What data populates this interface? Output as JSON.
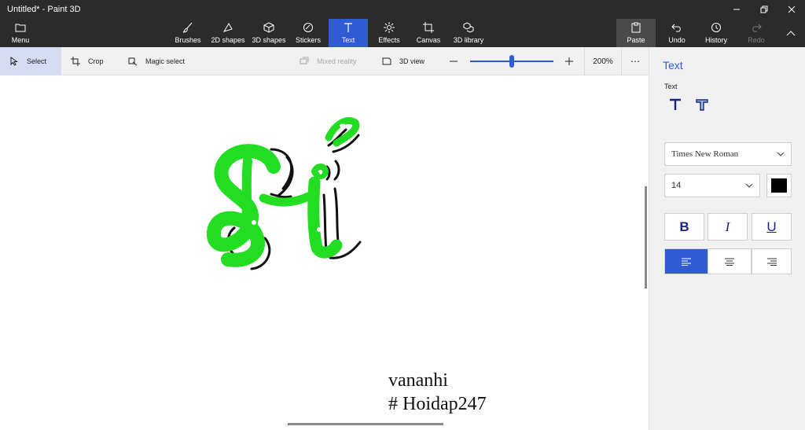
{
  "window": {
    "title": "Untitled* - Paint 3D"
  },
  "menu": {
    "label": "Menu"
  },
  "tools": [
    {
      "label": "Brushes",
      "icon": "brush-icon"
    },
    {
      "label": "2D shapes",
      "icon": "2d-shapes-icon"
    },
    {
      "label": "3D shapes",
      "icon": "3d-shapes-icon"
    },
    {
      "label": "Stickers",
      "icon": "stickers-icon"
    },
    {
      "label": "Text",
      "icon": "text-icon"
    },
    {
      "label": "Effects",
      "icon": "effects-icon"
    },
    {
      "label": "Canvas",
      "icon": "canvas-icon"
    },
    {
      "label": "3D library",
      "icon": "3d-library-icon"
    }
  ],
  "actions": {
    "paste": "Paste",
    "undo": "Undo",
    "history": "History",
    "redo": "Redo"
  },
  "subbar": {
    "select": "Select",
    "crop": "Crop",
    "magic_select": "Magic select",
    "mixed_reality": "Mixed reality",
    "view_3d": "3D view",
    "zoom": "200%",
    "zoom_fraction": 0.5
  },
  "canvas": {
    "line1": "vananhi",
    "line2": "# Hoidap247"
  },
  "panel": {
    "title": "Text",
    "subtitle": "Text",
    "font": "Times New Roman",
    "size": "14",
    "color": "#000000",
    "bold": "B",
    "italic": "I",
    "underline": "U"
  },
  "colors": {
    "accent": "#2f5bd3",
    "drawing_green": "#22dd22"
  }
}
